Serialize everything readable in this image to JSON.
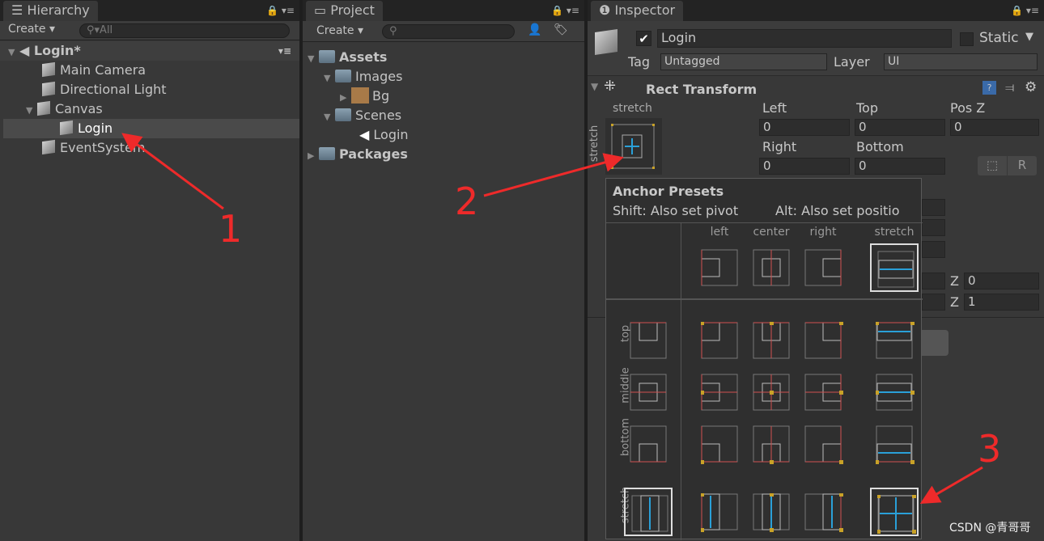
{
  "hierarchy": {
    "tab": "Hierarchy",
    "create": "Create ▾",
    "search_placeholder": "All",
    "scene": "Login*",
    "items": [
      {
        "label": "Main Camera"
      },
      {
        "label": "Directional Light"
      },
      {
        "label": "Canvas"
      },
      {
        "label": "Login",
        "selected": true
      },
      {
        "label": "EventSystem"
      }
    ]
  },
  "project": {
    "tab": "Project",
    "create": "Create ▾",
    "items": [
      {
        "label": "Assets"
      },
      {
        "label": "Images"
      },
      {
        "label": "Bg"
      },
      {
        "label": "Scenes"
      },
      {
        "label": "Login"
      },
      {
        "label": "Packages"
      }
    ]
  },
  "inspector": {
    "tab": "Inspector",
    "name": "Login",
    "active": true,
    "static_label": "Static",
    "tag_label": "Tag",
    "tag": "Untagged",
    "layer_label": "Layer",
    "layer": "UI",
    "component": "Rect Transform",
    "anchor_h": "stretch",
    "anchor_v": "stretch",
    "fields": {
      "left_label": "Left",
      "left": "0",
      "top_label": "Top",
      "top": "0",
      "posz_label": "Pos Z",
      "posz": "0",
      "right_label": "Right",
      "right": "0",
      "bottom_label": "Bottom",
      "bottom": "0"
    },
    "r_button": "R",
    "z_label": "Z",
    "rot_z": "0",
    "scale_z": "1"
  },
  "anchor_presets": {
    "title": "Anchor Presets",
    "shift_hint": "Shift: Also set pivot",
    "alt_hint": "Alt: Also set positio",
    "columns": [
      "left",
      "center",
      "right",
      "stretch"
    ],
    "rows": [
      "top",
      "middle",
      "bottom",
      "stretch"
    ],
    "selected": "stretch-stretch"
  },
  "annotations": {
    "n1": "1",
    "n2": "2",
    "n3": "3",
    "color": "#ee2a2a"
  },
  "watermark": "CSDN @青哥哥"
}
